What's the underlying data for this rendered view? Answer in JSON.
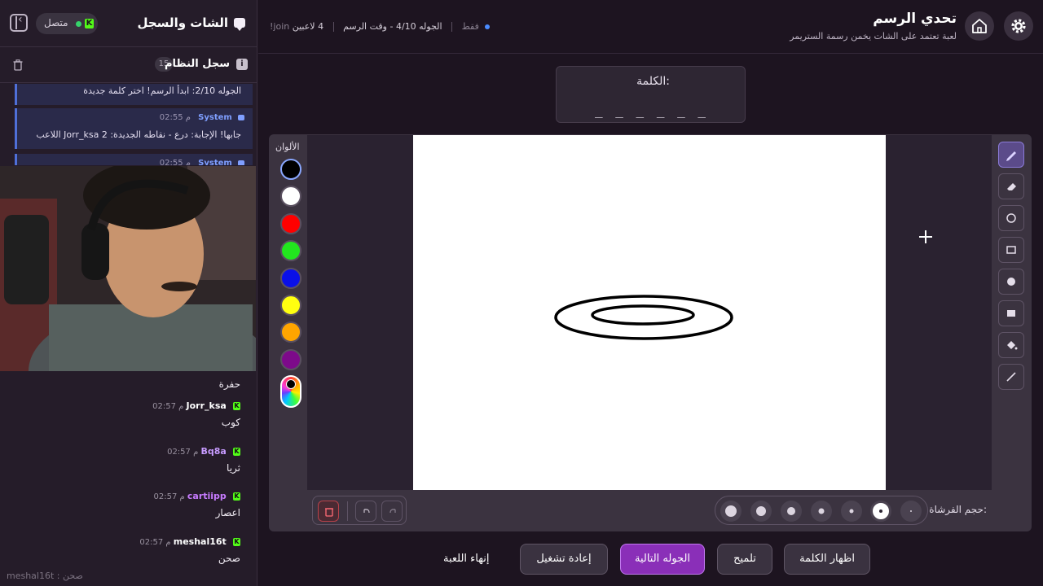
{
  "sidebar": {
    "title": "الشات والسجل",
    "connection_label": "متصل",
    "log": {
      "title": "سجل النظام",
      "count": "15",
      "items": [
        {
          "text": "الجوله 2/10: ابدأ الرسم! اختر كلمة جديدة"
        },
        {
          "user": "System",
          "time": "02:55 م",
          "text": "اللاعب Jorr_ksa جابها! الإجابة: درع - نقاطه الجديدة: 2"
        },
        {
          "user": "System",
          "time": "02:55 م"
        }
      ]
    },
    "chat": {
      "orphan_text": "حفرة",
      "messages": [
        {
          "user": "Jorr_ksa",
          "time": "02:57 م",
          "text": "كوب",
          "color": "#ffffff"
        },
        {
          "user": "Bq8a",
          "time": "02:57 م",
          "text": "ثريا",
          "color": "#c79bff"
        },
        {
          "user": "cartiipp",
          "time": "02:57 م",
          "text": "اعصار",
          "color": "#c77bff"
        },
        {
          "user": "meshal16t",
          "time": "02:57 م",
          "text": "صحن",
          "color": "#ffffff"
        }
      ],
      "input_preview": "meshal16t : صحن"
    }
  },
  "topbar": {
    "title": "تحدي الرسم",
    "subtitle": "لعبة تعتمد على الشات يخمن رسمة الستريمر",
    "players": "4 لاعبين",
    "round_info": "الجوله 4/10 - وقت الرسم",
    "join_hint": "!join فقط"
  },
  "word": {
    "label": "الكلمة:",
    "blanks": "_ _ _ _ _ _"
  },
  "palette": {
    "title": "الألوان",
    "colors": [
      "#000000",
      "#ffffff",
      "#ff0000",
      "#22e61e",
      "#0a10e8",
      "#ffff10",
      "#ffa500",
      "#7d0a8a"
    ],
    "selected": "#000000"
  },
  "tools": [
    "pen-icon",
    "eraser-icon",
    "circle-outline-icon",
    "rectangle-outline-icon",
    "circle-filled-icon",
    "rectangle-filled-icon",
    "fill-bucket-icon",
    "line-icon"
  ],
  "brush": {
    "label": "حجم الفرشاة:",
    "selected_index": 1
  },
  "footer": {
    "reveal_word": "اظهار الكلمة",
    "hint": "تلميح",
    "next_round": "الجوله التالية",
    "restart": "إعادة تشغيل",
    "end_game": "إنهاء اللعبة"
  },
  "colors": {
    "accent": "#8a2fb8",
    "kick_green": "#53fc18",
    "system_blue": "#7f9fff"
  }
}
